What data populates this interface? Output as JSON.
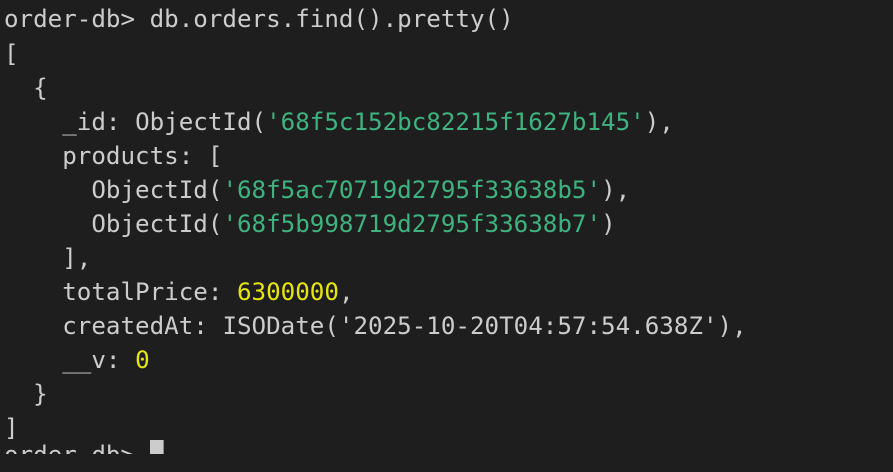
{
  "terminal": {
    "prompt": "order-db> ",
    "command": "db.orders.find().pretty()",
    "output": {
      "open_array": "[",
      "open_object": "  {",
      "id_key": "    _id: ",
      "id_func_open": "ObjectId(",
      "id_value": "'68f5c152bc82215f1627b145'",
      "id_func_close": "),",
      "products_key": "    products: [",
      "product_1_func_open": "      ObjectId(",
      "product_1_value": "'68f5ac70719d2795f33638b5'",
      "product_1_func_close": "),",
      "product_2_func_open": "      ObjectId(",
      "product_2_value": "'68f5b998719d2795f33638b7'",
      "product_2_func_close": ")",
      "products_close": "    ],",
      "total_key": "    totalPrice: ",
      "total_value": "6300000",
      "total_comma": ",",
      "created_key": "    createdAt: ",
      "created_value": "ISODate('2025-10-20T04:57:54.638Z'),",
      "v_key": "    __v: ",
      "v_value": "0",
      "close_object": "  }",
      "close_array": "]"
    },
    "next_prompt": "order-db> "
  },
  "colors": {
    "background": "#1e1e1e",
    "text": "#cccccc",
    "string": "#3fb37f",
    "number": "#e5e510"
  }
}
